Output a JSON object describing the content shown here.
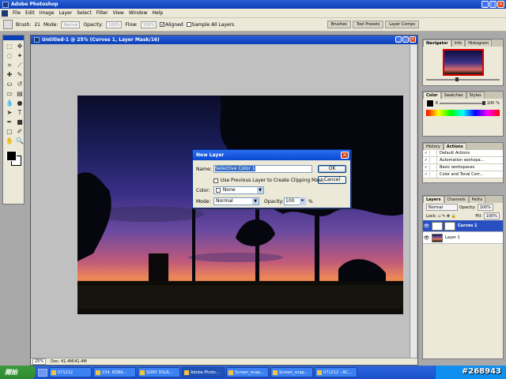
{
  "app": {
    "title": "Adobe Photoshop",
    "menu": [
      "File",
      "Edit",
      "Image",
      "Layer",
      "Select",
      "Filter",
      "View",
      "Window",
      "Help"
    ]
  },
  "options_bar": {
    "brush_label": "Brush:",
    "brush_size": "21",
    "mode_label": "Mode:",
    "mode_value": "Normal",
    "opacity_label": "Opacity:",
    "opacity_value": "100%",
    "flow_label": "Flow:",
    "flow_value": "100%",
    "aligned_label": "Aligned",
    "sample_label": "Sample All Layers",
    "well_tabs": [
      "Brushes",
      "Tool Presets",
      "Layer Comps"
    ]
  },
  "document": {
    "title": "Untitled-1 @ 25% (Curves 1, Layer Mask/16)",
    "zoom": "25%",
    "doc_size": "Doc: 41.4M/41.4M"
  },
  "dialog": {
    "title": "New Layer",
    "name_label": "Name:",
    "name_value": "Selective Color 1",
    "clip_label": "Use Previous Layer to Create Clipping Mask",
    "color_label": "Color:",
    "color_value": "None",
    "mode_label": "Mode:",
    "mode_value": "Normal",
    "opacity_label": "Opacity:",
    "opacity_value": "100",
    "percent": "%",
    "ok": "OK",
    "cancel": "Cancel"
  },
  "panels": {
    "navigator_tabs": [
      "Navigator",
      "Info",
      "Histogram"
    ],
    "color_tabs": [
      "Color",
      "Swatches",
      "Styles"
    ],
    "color_k_label": "K",
    "color_k_value": "100",
    "color_k_unit": "%",
    "history_tabs": [
      "History",
      "Actions"
    ],
    "actions": [
      "Default Actions",
      "Automation workspa...",
      "Basic workspaces",
      "Color and Tonal Corr..."
    ],
    "layers_tabs": [
      "Layers",
      "Channels",
      "Paths"
    ],
    "layers_mode": "Normal",
    "layers_opacity_label": "Opacity:",
    "layers_opacity": "100%",
    "lock_label": "Lock:",
    "fill_label": "Fill:",
    "fill_value": "100%",
    "layers": [
      "Curves 1",
      "Layer 1"
    ]
  },
  "taskbar": {
    "start": "開始",
    "tasks": [
      "071212",
      "154. KOBA...",
      "SONY DSLR...",
      "Adobe Photo...",
      "Screen_snap...",
      "Screen_snap...",
      "071212 - AC..."
    ],
    "watermark": "#268943"
  },
  "colors": {
    "title_blue": "#0a3fb8",
    "xp_gray": "#ece9d8",
    "selected_layer": "#2a4fc0",
    "start_green": "#2f8a2f"
  }
}
